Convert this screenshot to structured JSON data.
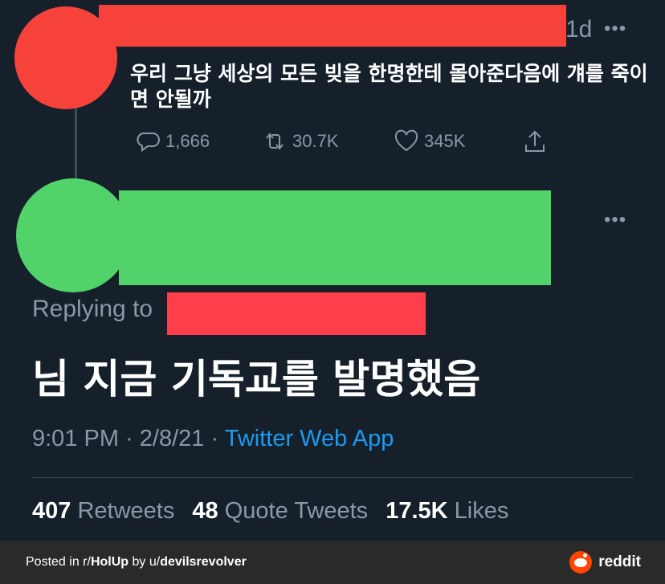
{
  "first_tweet": {
    "time": "1d",
    "more": "•••",
    "text": "우리 그냥 세상의 모든 빚을 한명한테 몰아준다음에 걔를 죽이면 안될까",
    "replies": "1,666",
    "retweets": "30.7K",
    "likes": "345K"
  },
  "second_tweet": {
    "more": "•••",
    "replying_to": "Replying to",
    "text": "님 지금 기독교를 발명했음",
    "time": "9:01 PM",
    "date": "2/8/21",
    "separator": "·",
    "source": "Twitter Web App",
    "retweets_count": "407",
    "retweets_label": "Retweets",
    "quotes_count": "48",
    "quotes_label": "Quote Tweets",
    "likes_count": "17.5K",
    "likes_label": "Likes"
  },
  "footer": {
    "posted_in": "Posted in r/",
    "subreddit": "HolUp",
    "by": " by u/",
    "username": "devilsrevolver",
    "brand": "reddit"
  },
  "colors": {
    "background": "#15202b",
    "redact_red": "#f7423b",
    "redact_green": "#52d36a",
    "link_blue": "#1d9bf0",
    "muted": "#8b98a5"
  }
}
